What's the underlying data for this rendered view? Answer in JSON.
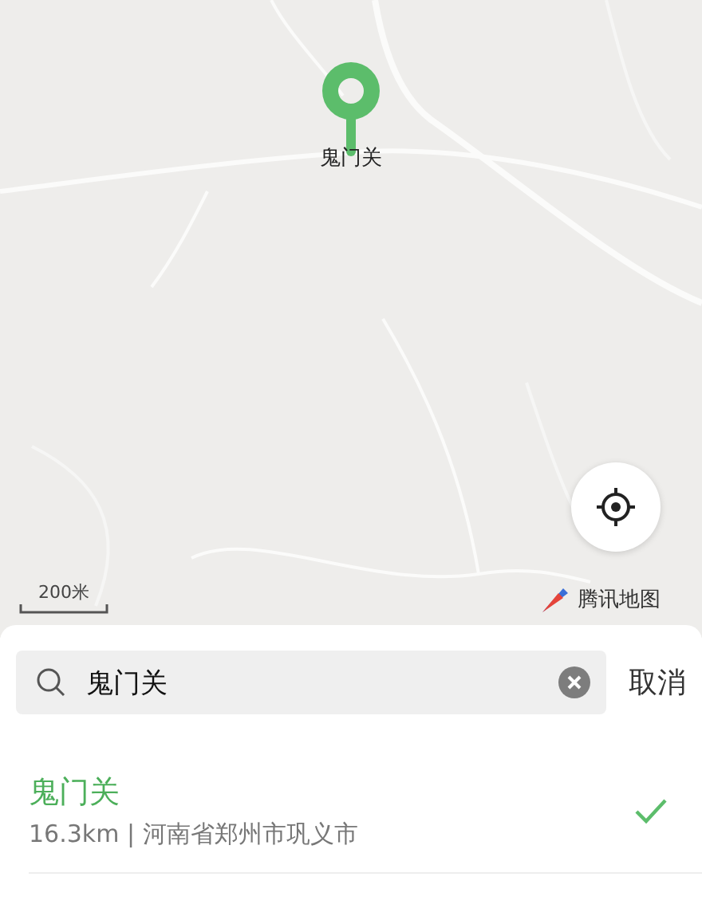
{
  "map": {
    "pin": {
      "label": "鬼门关"
    },
    "scale": "200米",
    "provider": "腾讯地图"
  },
  "search": {
    "value": "鬼门关",
    "cancel": "取消"
  },
  "results": [
    {
      "name": "鬼门关",
      "detail": "16.3km | 河南省郑州市巩义市",
      "selected": true
    }
  ]
}
